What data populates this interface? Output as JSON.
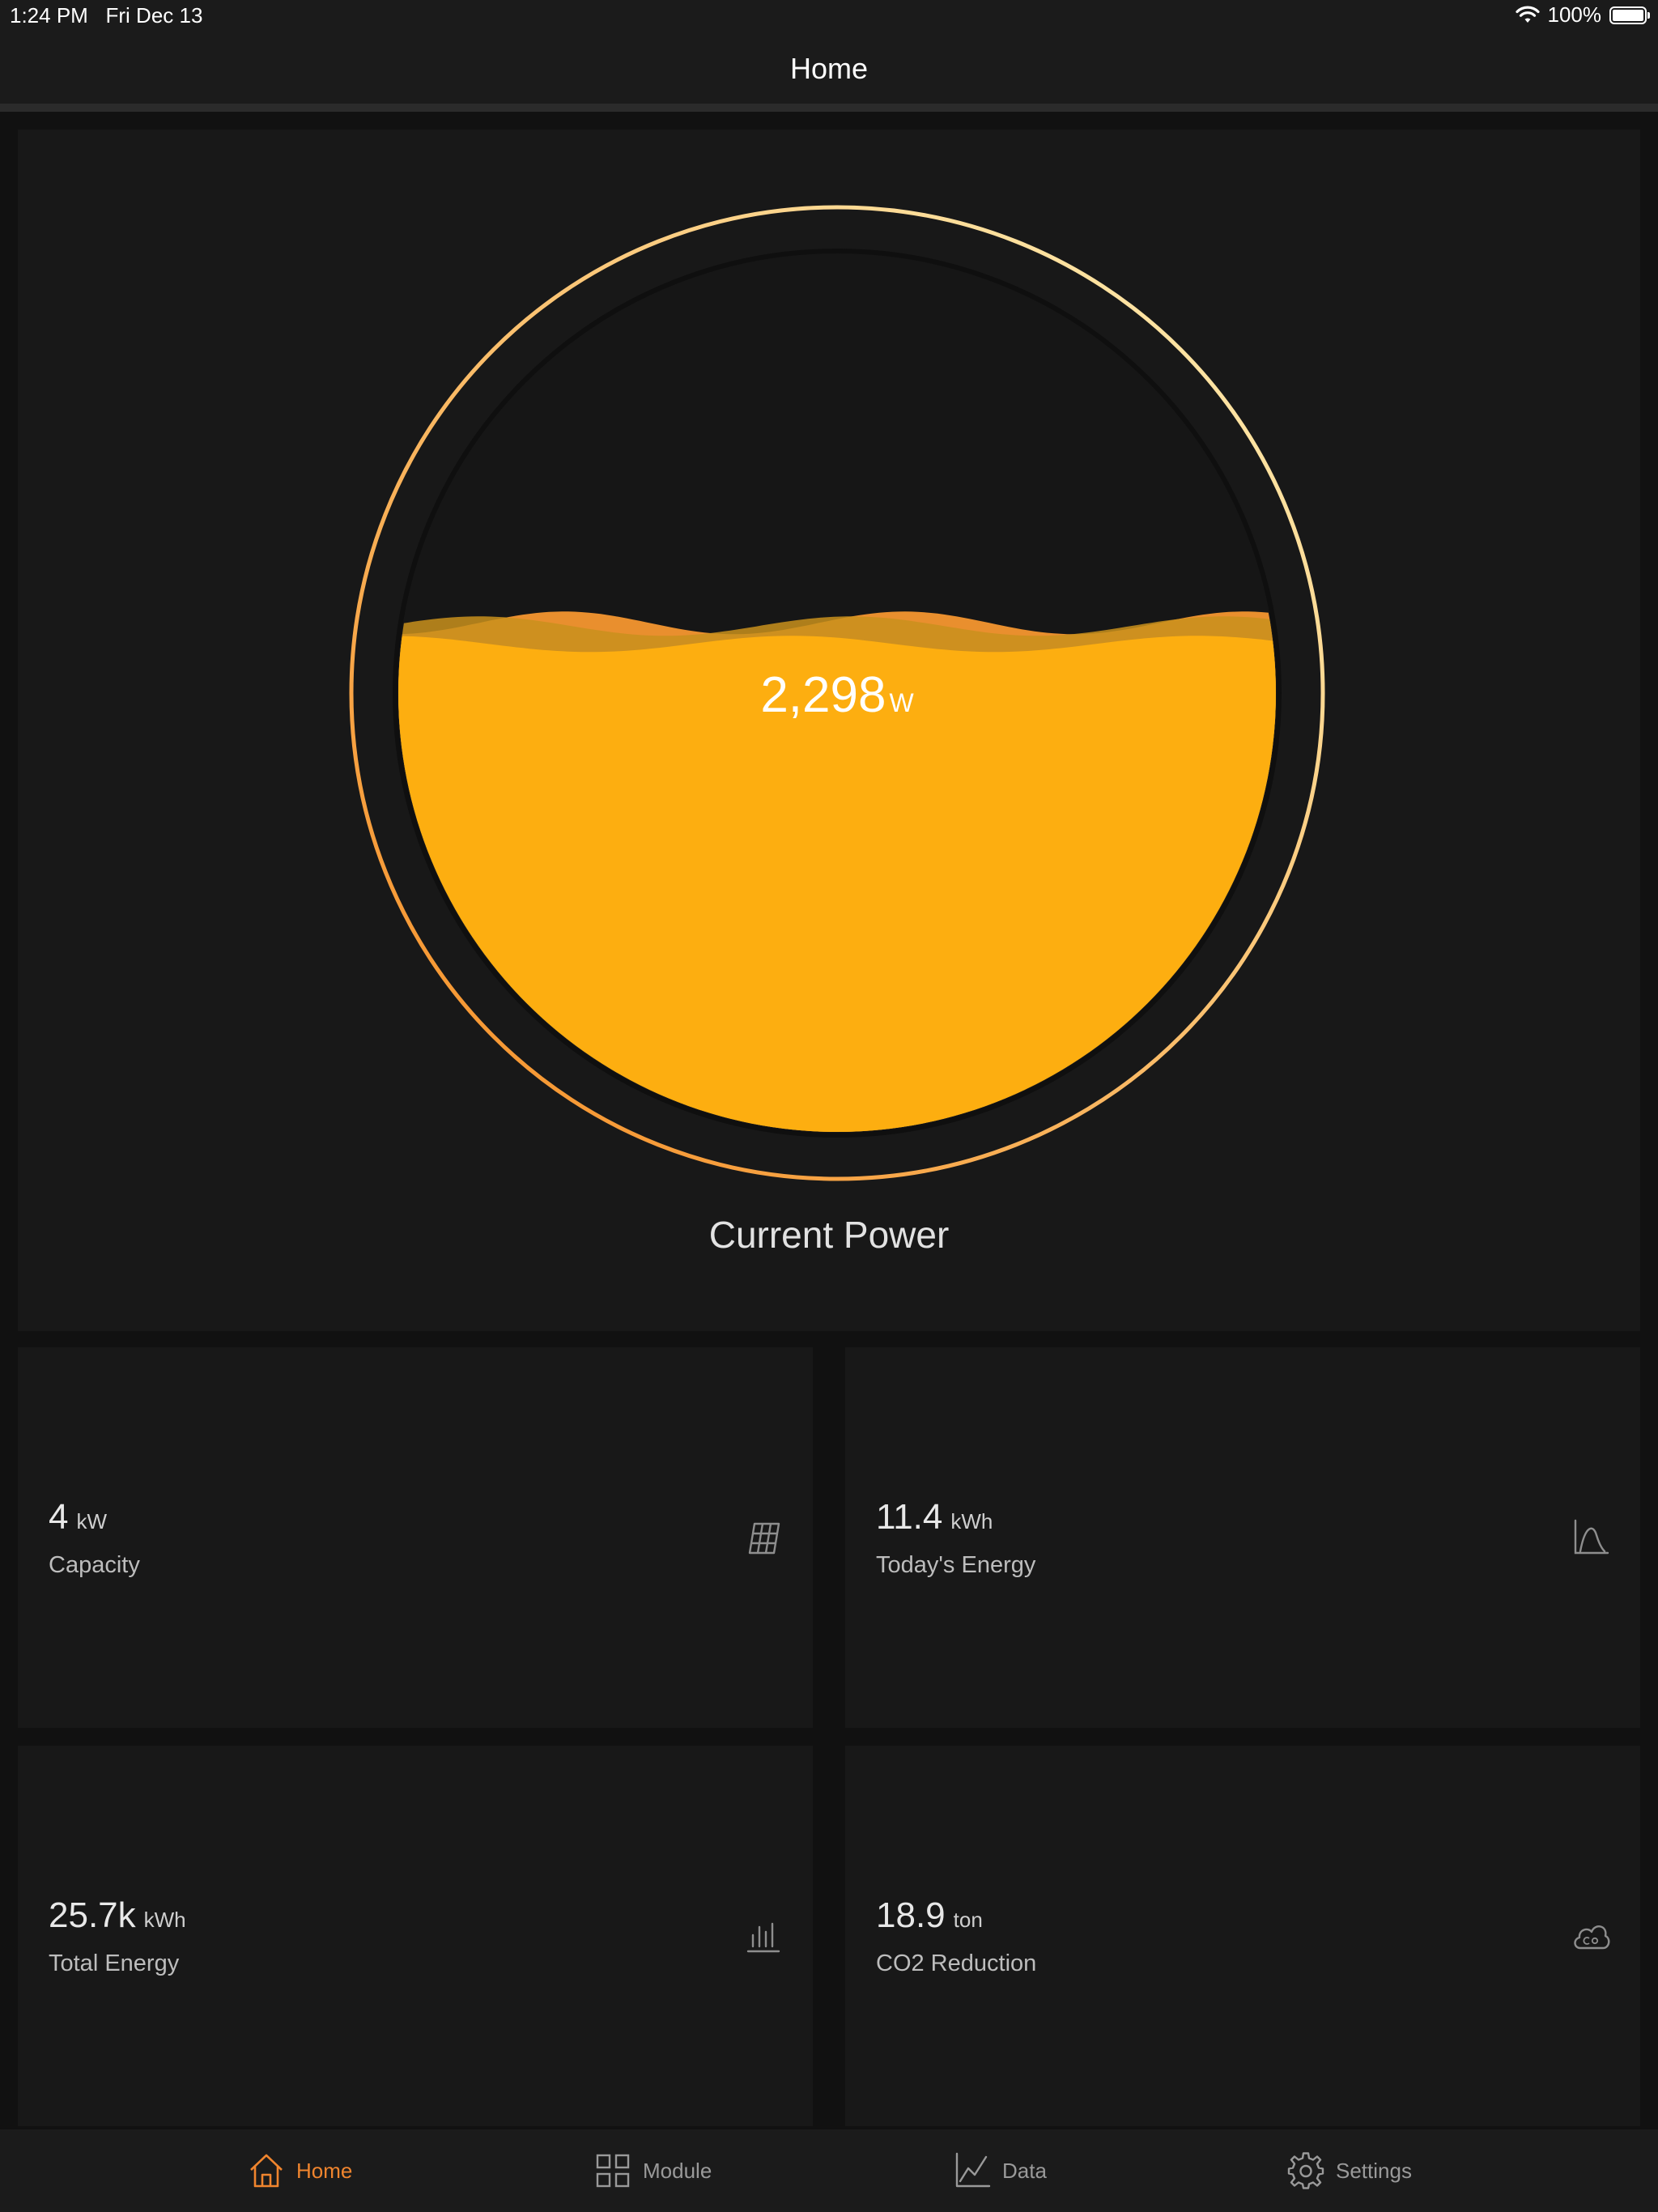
{
  "status_bar": {
    "time": "1:24 PM",
    "date": "Fri Dec 13",
    "battery": "100%",
    "battery_level": 1.0,
    "wifi_icon": "wifi-icon",
    "battery_icon": "battery-icon"
  },
  "nav": {
    "title": "Home"
  },
  "current_power": {
    "value": "2,298",
    "unit": "W",
    "label": "Current Power",
    "fill_level": 0.58,
    "colors": {
      "fill": "#FDAE10",
      "wave_back": "#E98F2E",
      "wave_mid": "#C9911C",
      "ring_start": "#F58A1F",
      "ring_end": "#FFF2B8"
    }
  },
  "stats": [
    {
      "id": "capacity",
      "value": "4",
      "unit": "kW",
      "label": "Capacity",
      "icon": "solar-panel-icon"
    },
    {
      "id": "todays-energy",
      "value": "11.4",
      "unit": "kWh",
      "label": "Today's Energy",
      "icon": "curve-chart-icon"
    },
    {
      "id": "total-energy",
      "value": "25.7k",
      "unit": "kWh",
      "label": "Total Energy",
      "icon": "bar-chart-icon"
    },
    {
      "id": "co2-reduction",
      "value": "18.9",
      "unit": "ton",
      "label": "CO2 Reduction",
      "icon": "co2-cloud-icon"
    }
  ],
  "tabs": [
    {
      "label": "Home",
      "icon": "home-icon",
      "active": true
    },
    {
      "label": "Module",
      "icon": "grid-icon",
      "active": false
    },
    {
      "label": "Data",
      "icon": "line-chart-icon",
      "active": false
    },
    {
      "label": "Settings",
      "icon": "gear-icon",
      "active": false
    }
  ],
  "accent_color": "#F0852E"
}
